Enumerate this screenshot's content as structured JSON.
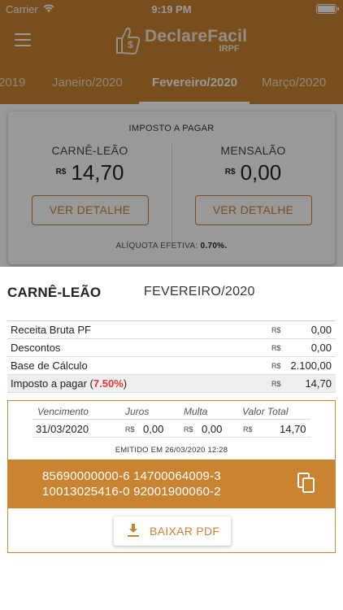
{
  "status_bar": {
    "carrier": "Carrier",
    "time": "9:19 PM"
  },
  "header": {
    "menu_icon": "hamburger-menu-icon",
    "logo_text": "DeclareFacil",
    "logo_sub": "IRPF"
  },
  "tabs": {
    "items": [
      {
        "label": "2019"
      },
      {
        "label": "Janeiro/2020"
      },
      {
        "label": "Fevereiro/2020",
        "active": true
      },
      {
        "label": "Março/2020"
      }
    ]
  },
  "summary": {
    "title": "IMPOSTO A PAGAR",
    "carne": {
      "label": "CARNÊ-LEÃO",
      "currency": "R$",
      "value": "14,70",
      "button": "VER DETALHE"
    },
    "mensalao": {
      "label": "MENSALÃO",
      "currency": "R$",
      "value": "0,00",
      "button": "VER DETALHE"
    },
    "aliquota_label": "ALÍQUOTA EFETIVA:",
    "aliquota_value": "0.70%."
  },
  "detail": {
    "kind": "CARNÊ-LEÃO",
    "period": "FEVEREIRO/2020",
    "rows": [
      {
        "label": "Receita Bruta PF",
        "currency": "R$",
        "value": "0,00"
      },
      {
        "label": "Descontos",
        "currency": "R$",
        "value": "0,00"
      },
      {
        "label": "Base de Cálculo",
        "currency": "R$",
        "value": "2.100,00"
      },
      {
        "label": "Imposto a pagar (",
        "pct": "7.50%",
        "label_end": ")",
        "currency": "R$",
        "value": "14,70"
      }
    ],
    "boleto": {
      "headers": {
        "vencimento": "Vencimento",
        "juros": "Juros",
        "multa": "Multa",
        "total": "Valor Total"
      },
      "values": {
        "vencimento": "31/03/2020",
        "juros_cur": "R$",
        "juros": "0,00",
        "multa_cur": "R$",
        "multa": "0,00",
        "total_cur": "R$",
        "total": "14,70"
      },
      "emitido": "EMITIDO EM 26/03/2020 12:28",
      "code_line1": "85690000000-6 14700064009-3",
      "code_line2": "10013025416-0 92001900060-2",
      "copy_icon": "copy-icon",
      "pdf_button": "BAIXAR PDF",
      "pdf_icon": "download-icon"
    }
  },
  "colors": {
    "brand": "#c98331",
    "highlight_pct": "#e53935"
  }
}
